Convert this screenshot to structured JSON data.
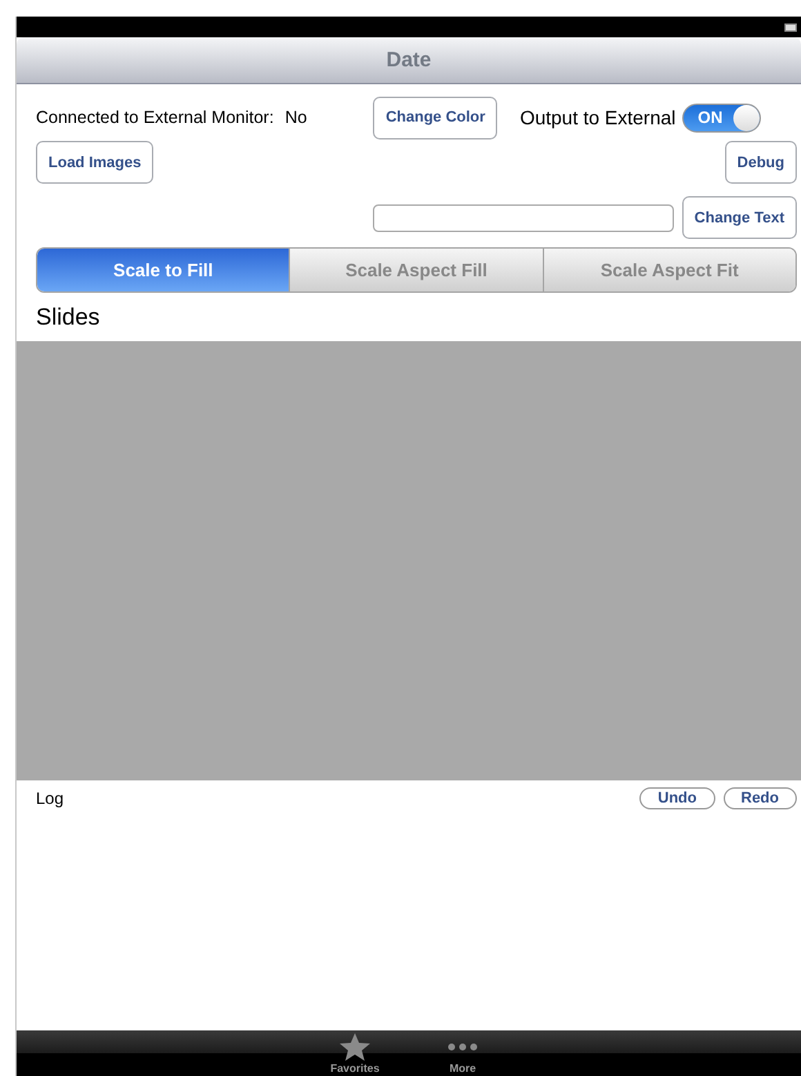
{
  "navigation_bar": {
    "title": "Date"
  },
  "controls": {
    "monitor_label": "Connected to External Monitor:",
    "monitor_value": "No",
    "change_color_button": "Change Color",
    "output_label": "Output to External",
    "output_switch": {
      "label": "ON",
      "on": true
    },
    "load_images_button": "Load Images",
    "debug_button": "Debug",
    "change_text_button": "Change Text"
  },
  "segments": [
    {
      "label": "Scale to Fill",
      "selected": true
    },
    {
      "label": "Scale Aspect Fill",
      "selected": false
    },
    {
      "label": "Scale Aspect Fit",
      "selected": false
    }
  ],
  "slides": {
    "title": "Slides"
  },
  "log": {
    "title": "Log",
    "buttons": [
      "Undo",
      "Redo"
    ]
  },
  "tab_bar": [
    {
      "label": "Favorites",
      "kind": "star",
      "selected": false
    },
    {
      "label": "More",
      "kind": "more",
      "selected": false
    }
  ]
}
